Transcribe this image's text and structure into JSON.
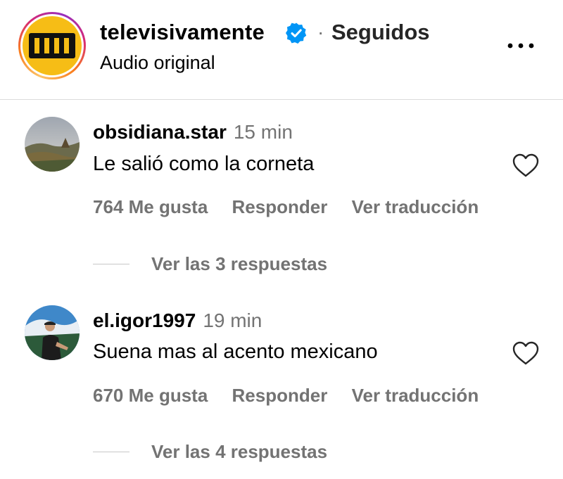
{
  "header": {
    "username": "televisivamente",
    "separator": "·",
    "follow_state": "Seguidos",
    "subtitle": "Audio original",
    "verified_icon": "verified-badge-icon",
    "more_icon": "more-horizontal-icon",
    "brand_color": "#f6bd16",
    "verified_color": "#0095f6"
  },
  "comments": [
    {
      "username": "obsidiana.star",
      "time": "15 min",
      "text": "Le salió como la corneta",
      "likes": "764 Me gusta",
      "reply": "Responder",
      "translate": "Ver traducción",
      "view_replies": "Ver las 3 respuestas",
      "like_icon": "heart-outline-icon"
    },
    {
      "username": "el.igor1997",
      "time": "19 min",
      "text": "Suena mas al acento mexicano",
      "likes": "670 Me gusta",
      "reply": "Responder",
      "translate": "Ver traducción",
      "view_replies": "Ver las 4 respuestas",
      "like_icon": "heart-outline-icon"
    }
  ],
  "colors": {
    "secondary_text": "#737373",
    "divider": "#dbdbdb"
  }
}
